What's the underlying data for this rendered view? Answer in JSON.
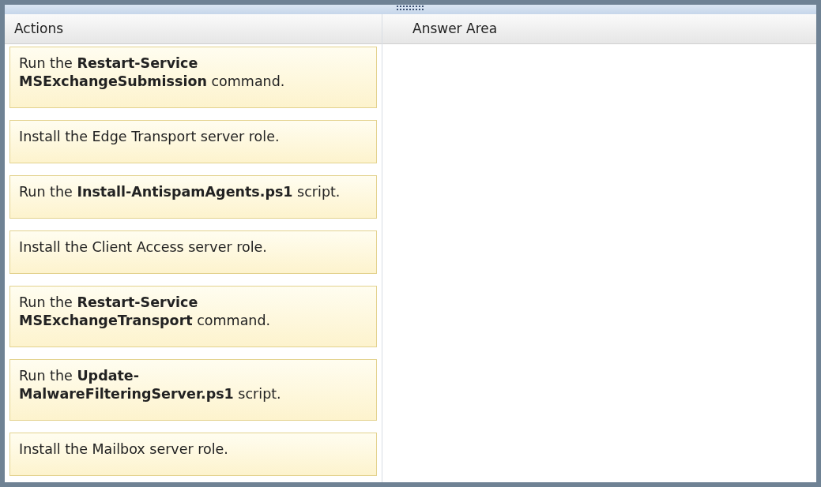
{
  "actions_panel": {
    "title": "Actions",
    "items": [
      {
        "text": "Run the **Restart-Service MSExchangeSubmission** command."
      },
      {
        "text": "Install the Edge Transport server role."
      },
      {
        "text": "Run the **Install-AntispamAgents.ps1** script."
      },
      {
        "text": "Install the Client Access server role."
      },
      {
        "text": "Run the **Restart-Service MSExchangeTransport** command."
      },
      {
        "text": "Run the **Update-MalwareFilteringServer.ps1** script."
      },
      {
        "text": "Install the Mailbox server role."
      }
    ]
  },
  "answer_panel": {
    "title": "Answer Area"
  }
}
